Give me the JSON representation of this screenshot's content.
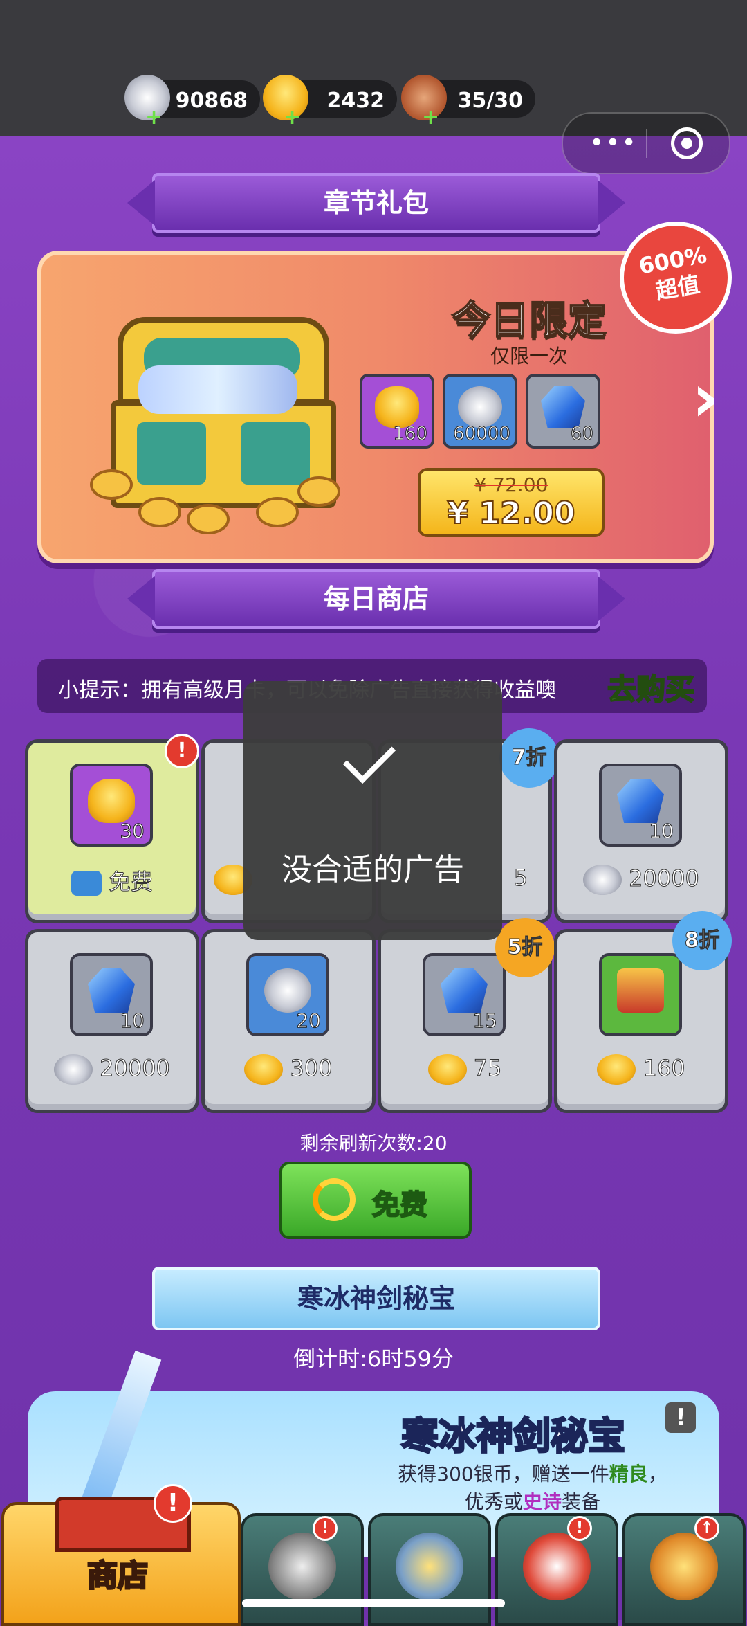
{
  "resources": [
    {
      "name": "silver-coin",
      "value": "90868"
    },
    {
      "name": "gold-ingot",
      "value": "2432"
    },
    {
      "name": "stamina-meat",
      "value": "35/30"
    }
  ],
  "sections": {
    "chapter_pack": "章节礼包",
    "daily_shop": "每日商店",
    "ice_sword": "寒冰神剑秘宝"
  },
  "pack": {
    "badge_line1": "600%",
    "badge_line2": "超值",
    "title": "今日限定",
    "subtitle": "仅限一次",
    "items": [
      {
        "icon": "gold-ingot-icon",
        "count": "160"
      },
      {
        "icon": "silver-coin-icon",
        "count": "60000"
      },
      {
        "icon": "blue-gem-medal-icon",
        "count": "60"
      }
    ],
    "old_price": "¥ 72.00",
    "price": "¥ 12.00"
  },
  "tip": {
    "text": "小提示：拥有高级月卡，可以免除广告直接获得收益噢",
    "action": "去购买"
  },
  "shop": [
    {
      "icon": "gold-ingot-icon",
      "count": "30",
      "price_icon": "tv-ad-icon",
      "price": "免费",
      "discount": "",
      "alert": true
    },
    {
      "icon": "",
      "count": "",
      "price_icon": "gold-ingot-icon",
      "price": "",
      "discount": "",
      "alert": false
    },
    {
      "icon": "",
      "count": "",
      "price_icon": "",
      "price": "5",
      "discount": "7折",
      "alert": false
    },
    {
      "icon": "blue-gem-boot-icon",
      "count": "10",
      "price_icon": "silver-coin-icon",
      "price": "20000",
      "discount": "",
      "alert": false
    },
    {
      "icon": "blue-gem-scroll-icon",
      "count": "10",
      "price_icon": "silver-coin-icon",
      "price": "20000",
      "discount": "",
      "alert": false
    },
    {
      "icon": "silver-coin-fast-icon",
      "count": "20",
      "price_icon": "gold-ingot-icon",
      "price": "300",
      "discount": "",
      "alert": false
    },
    {
      "icon": "blue-gem-medal-icon",
      "count": "15",
      "price_icon": "gold-ingot-icon",
      "price": "75",
      "discount": "5折",
      "alert": false
    },
    {
      "icon": "armor-icon",
      "count": "",
      "price_icon": "gold-ingot-icon",
      "price": "160",
      "discount": "8折",
      "alert": false
    }
  ],
  "toast": {
    "message": "没合适的广告"
  },
  "refresh": {
    "label": "剩余刷新次数:20",
    "button": "免费"
  },
  "ice": {
    "countdown": "倒计时:6时59分",
    "title": "寒冰神剑秘宝",
    "desc_prefix": "获得300银币，赠送一件",
    "desc_good": "精良",
    "desc_comma": "，",
    "desc_excellent": "优秀",
    "desc_or": "或",
    "desc_epic": "史诗",
    "desc_suffix": "装备"
  },
  "nav": {
    "shop": "商店"
  },
  "colors": {
    "accent": "#7d3bb8",
    "free_green": "#3aa828",
    "gold": "#f4b51a"
  }
}
